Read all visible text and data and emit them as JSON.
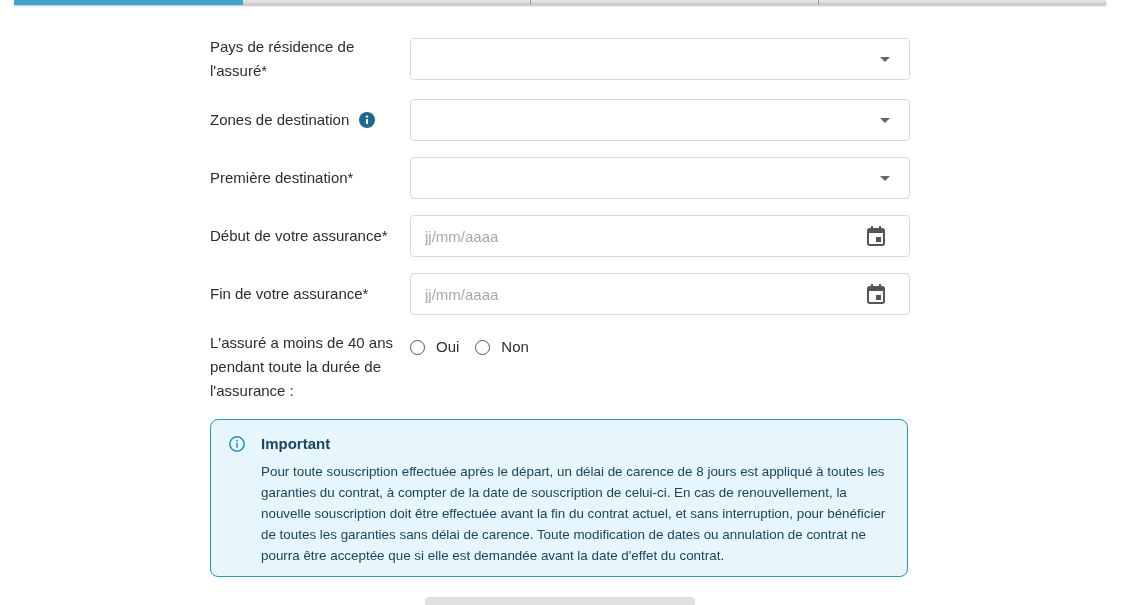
{
  "progress_steps": [
    {
      "selected": true
    },
    {
      "selected": false
    },
    {
      "selected": false
    },
    {
      "selected": false
    }
  ],
  "fields": [
    {
      "kind": "select",
      "label": "Pays de résidence de l'assuré*",
      "info": false
    },
    {
      "kind": "select",
      "label": "Zones de destination",
      "info": true
    },
    {
      "kind": "select",
      "label": "Première destination*",
      "info": false
    },
    {
      "kind": "date",
      "label": "Début de votre assurance*",
      "placeholder": "jj/mm/aaaa",
      "info": false
    },
    {
      "kind": "date",
      "label": "Fin de votre assurance*",
      "placeholder": "jj/mm/aaaa",
      "info": false
    },
    {
      "kind": "radio",
      "label": "L'assuré a moins de 40 ans pendant toute la durée de l'assurance :",
      "info": false,
      "options": [
        {
          "label": "Oui",
          "selected": false
        },
        {
          "label": "Non",
          "selected": false
        }
      ]
    }
  ],
  "notice": {
    "title": "Important",
    "text": "Pour toute souscription effectuée après le départ, un délai de carence de 8 jours est appliqué à toutes les garanties du contrat, à compter de la date de souscription de celui-ci. En cas de renouvellement, la nouvelle souscription doit être effectuée avant la fin du contrat actuel, et sans interruption, pour bénéficier de toutes les garanties sans délai de carence. Toute modification de dates ou annulation de contrat ne pourra être acceptée que si elle est demandée avant la date d'effet du contrat."
  },
  "button": {
    "disabled": true
  }
}
